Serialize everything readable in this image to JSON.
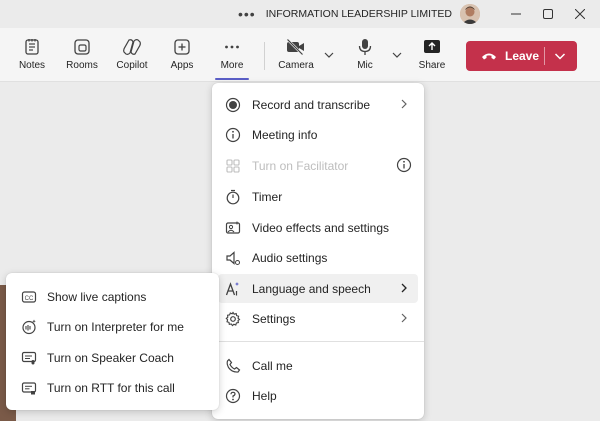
{
  "titlebar": {
    "org_name": "INFORMATION LEADERSHIP LIMITED",
    "more_dots": "•••"
  },
  "toolbar": {
    "items": [
      {
        "label": "Notes",
        "icon": "notes-icon"
      },
      {
        "label": "Rooms",
        "icon": "rooms-icon"
      },
      {
        "label": "Copilot",
        "icon": "copilot-icon"
      },
      {
        "label": "Apps",
        "icon": "apps-icon"
      },
      {
        "label": "More",
        "icon": "more-icon"
      },
      {
        "label": "Camera",
        "icon": "camera-off-icon"
      },
      {
        "label": "Mic",
        "icon": "mic-icon"
      },
      {
        "label": "Share",
        "icon": "share-icon"
      }
    ],
    "leave_label": "Leave",
    "leave_color": "#c4314b",
    "accent_color": "#5b5fc7"
  },
  "more_menu": {
    "items": [
      {
        "label": "Record and transcribe",
        "icon": "record-icon",
        "submenu": true
      },
      {
        "label": "Meeting info",
        "icon": "info-icon"
      },
      {
        "label": "Turn on Facilitator",
        "icon": "facilitator-icon",
        "disabled": true
      },
      {
        "label": "Timer",
        "icon": "timer-icon"
      },
      {
        "label": "Video effects and settings",
        "icon": "video-effects-icon"
      },
      {
        "label": "Audio settings",
        "icon": "audio-settings-icon"
      },
      {
        "label": "Language and speech",
        "icon": "language-icon",
        "submenu": true,
        "highlighted": true
      },
      {
        "label": "Settings",
        "icon": "settings-icon",
        "submenu": true
      },
      {
        "label": "Call me",
        "icon": "phone-icon"
      },
      {
        "label": "Help",
        "icon": "help-icon"
      }
    ]
  },
  "language_submenu": {
    "items": [
      {
        "label": "Show live captions",
        "icon": "captions-icon"
      },
      {
        "label": "Turn on Interpreter for me",
        "icon": "interpreter-icon"
      },
      {
        "label": "Turn on Speaker Coach",
        "icon": "speaker-coach-icon"
      },
      {
        "label": "Turn on RTT for this call",
        "icon": "rtt-icon"
      }
    ]
  }
}
